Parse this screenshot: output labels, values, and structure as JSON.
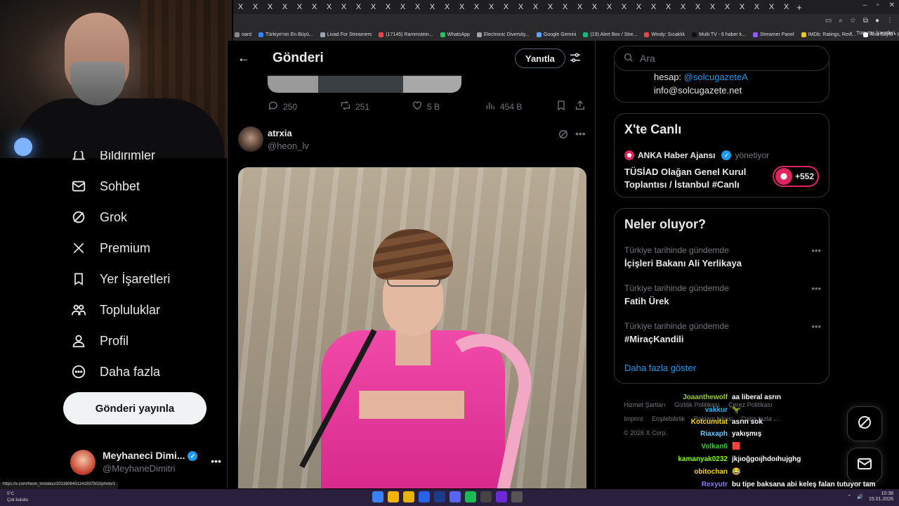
{
  "browser": {
    "tab_close_glyph": "X",
    "new_tab_glyph": "+",
    "window_controls": [
      "–",
      "▫",
      "✕"
    ],
    "bookmarks": [
      {
        "label": "oard",
        "color": "#888888"
      },
      {
        "label": "Türkiye'nin En Büyü...",
        "color": "#3b82f6"
      },
      {
        "label": "Livad For Streamers",
        "color": "#9ca3af"
      },
      {
        "label": "(17145) Rammstein...",
        "color": "#ef4444"
      },
      {
        "label": "WhatsApp",
        "color": "#22c55e"
      },
      {
        "label": "Electronic Diversity...",
        "color": "#9ca3af"
      },
      {
        "label": "Google Gemini",
        "color": "#60a5fa"
      },
      {
        "label": "(19) Alert Box / Stre...",
        "color": "#10b981"
      },
      {
        "label": "Windy: Sıcaklık",
        "color": "#ef4444"
      },
      {
        "label": "Multi TV - 6 haber k...",
        "color": "#111111"
      },
      {
        "label": "Streamer Panel",
        "color": "#8b5cf6"
      },
      {
        "label": "IMDb: Ratings, Revi...",
        "color": "#f5c518"
      },
      {
        "label": "Ana Sayfa • HBO Max",
        "color": "#ffffff"
      }
    ],
    "bookmarks_more": "»",
    "bookmarks_folder": "Tüm Yer İşaretleri"
  },
  "sidebar": {
    "items": [
      {
        "label": "Bildirimler",
        "icon": "bell-icon"
      },
      {
        "label": "Sohbet",
        "icon": "envelope-icon"
      },
      {
        "label": "Grok",
        "icon": "grok-icon"
      },
      {
        "label": "Premium",
        "icon": "x-logo-icon"
      },
      {
        "label": "Yer İşaretleri",
        "icon": "bookmark-icon"
      },
      {
        "label": "Topluluklar",
        "icon": "people-icon"
      },
      {
        "label": "Profil",
        "icon": "person-icon"
      },
      {
        "label": "Daha fazla",
        "icon": "more-circle-icon"
      }
    ],
    "post_button": "Gönderi yayınla",
    "account": {
      "name": "Meyhaneci Dimi...",
      "handle": "@MeyhaneDimitri",
      "more": "•••"
    }
  },
  "main": {
    "header_title": "Gönderi",
    "back_glyph": "←",
    "reply_button": "Yanıtla",
    "prev_post_stats": {
      "replies": "250",
      "reposts": "251",
      "likes": "5 B",
      "views": "454 B"
    },
    "tweet": {
      "name": "atrxia",
      "handle": "@heon_lv",
      "more": "•••"
    }
  },
  "right": {
    "search_placeholder": "Ara",
    "contact": {
      "prefix": "hesap: ",
      "account": "@solcugazeteA",
      "email": "info@solcugazete.net"
    },
    "live": {
      "title": "X'te Canlı",
      "source": "ANKA Haber Ajansı",
      "role": "yönetiyor",
      "broadcast": "TÜSİAD Olağan Genel Kurul Toplantısı / İstanbul #Canlı",
      "count": "+552"
    },
    "trends": {
      "title": "Neler oluyor?",
      "items": [
        {
          "context": "Türkiye tarihinde gündemde",
          "name": "İçişleri Bakanı Ali Yerlikaya"
        },
        {
          "context": "Türkiye tarihinde gündemde",
          "name": "Fatih Ürek"
        },
        {
          "context": "Türkiye tarihinde gündemde",
          "name": "#MiraçKandili"
        }
      ],
      "show_more": "Daha fazla göster"
    },
    "footer": [
      "Hizmet Şartları",
      "Gizlilik Politikası",
      "Çerez Politikası",
      "Imprint",
      "Erişilebilirlik",
      "Reklam bilgisi",
      "Daha fazla ...",
      "© 2026 X Corp."
    ]
  },
  "chat": {
    "messages": [
      {
        "user": "Joaanthewolf",
        "text": "aa liberal asrın",
        "color": "#9acd32"
      },
      {
        "user": "vakkur",
        "text": "🦖",
        "color": "#00bfff"
      },
      {
        "user": "Kotcumitat",
        "text": "asrın sok",
        "color": "#ffd700"
      },
      {
        "user": "Riaxaph",
        "text": "yakışmış",
        "color": "#66ccff"
      },
      {
        "user": "Volkan6",
        "text": "🟥",
        "color": "#32cd32"
      },
      {
        "user": "kamanyak0232",
        "text": "jkjıoğgoıjhdoıhujghg",
        "color": "#7fff00"
      },
      {
        "user": "obitochan",
        "text": "😂",
        "color": "#ffd700"
      },
      {
        "user": "Rexyutr",
        "text": "bu tipe baksana abi keleş falan tutuyor tam terörist",
        "color": "#8a7dff"
      }
    ]
  },
  "statusbar": {
    "url": "https://x.com/heon_lv/status/2011606431141937502/photo/1"
  },
  "taskbar": {
    "weather_temp": "5°C",
    "weather_desc": "Çok bulutlu",
    "time": "10:38",
    "date": "15.01.2026"
  }
}
